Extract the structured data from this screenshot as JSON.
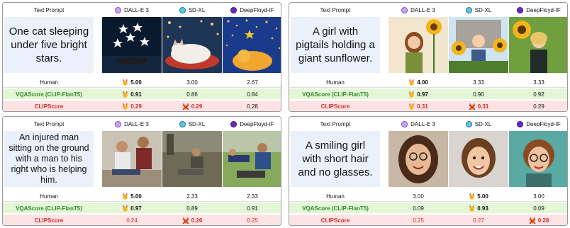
{
  "columns": {
    "prompt": "Text Prompt",
    "models": [
      "DALL-E 3",
      "SD-XL",
      "DeepFloyd-IF"
    ]
  },
  "row_labels": {
    "human": "Human",
    "vqa": "VQAScore (CLIP-FlanT5)",
    "clip": "CLIPScore"
  },
  "colors": {
    "vqa_text": "#2f8a2a",
    "vqa_bg": "#e3f6d5",
    "clip_text": "#d42a2a",
    "clip_bg": "#fde3e3",
    "prompt_bg": "#eaf1fb"
  },
  "panels": [
    {
      "prompt": "One cat sleeping under five bright stars.",
      "human": [
        "5.00",
        "3.00",
        "2.67"
      ],
      "vqa": [
        "0.91",
        "0.86",
        "0.84"
      ],
      "clip": [
        "0.29",
        "0.29",
        "0.28"
      ],
      "human_best": 0,
      "vqa_best": 0,
      "clip_best": 0,
      "clip_wrong": 1
    },
    {
      "prompt": "A girl with pigtails holding a giant sunflower.",
      "human": [
        "4.00",
        "3.33",
        "3.33"
      ],
      "vqa": [
        "0.97",
        "0.90",
        "0.92"
      ],
      "clip": [
        "0.31",
        "0.31",
        "0.29"
      ],
      "human_best": 0,
      "vqa_best": 0,
      "clip_best": 0,
      "clip_wrong": 1
    },
    {
      "prompt": "An injured man sitting on the ground with a man to his right who is helping him.",
      "human": [
        "5.00",
        "2.33",
        "2.33"
      ],
      "vqa": [
        "0.97",
        "0.89",
        "0.91"
      ],
      "clip": [
        "0.24",
        "0.26",
        "0.25"
      ],
      "human_best": 0,
      "vqa_best": 0,
      "clip_best": -1,
      "clip_wrong": 1
    },
    {
      "prompt": "A smiling girl with short hair and no glasses.",
      "human": [
        "3.00",
        "5.00",
        "3.00"
      ],
      "vqa": [
        "0.09",
        "0.93",
        "0.09"
      ],
      "clip": [
        "0.25",
        "0.27",
        "0.28"
      ],
      "human_best": 1,
      "vqa_best": 1,
      "clip_best": -1,
      "clip_wrong": 2
    }
  ]
}
